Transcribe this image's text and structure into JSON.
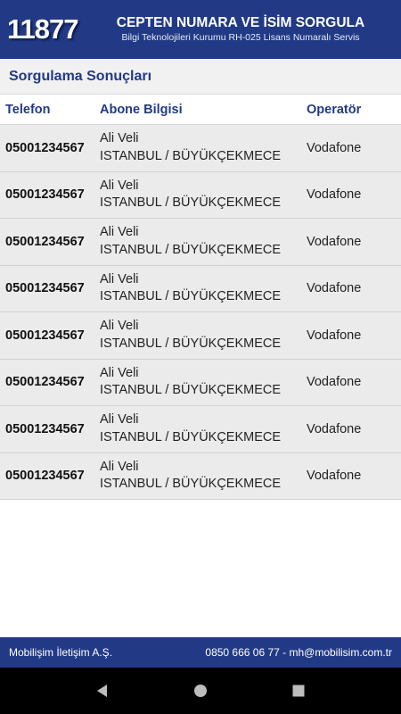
{
  "header": {
    "logo": "11877",
    "title": "CEPTEN NUMARA VE İSİM SORGULA",
    "subtitle": "Bilgi Teknolojileri Kurumu RH-025 Lisans Numaralı Servis"
  },
  "section": {
    "title": "Sorgulama Sonuçları"
  },
  "table": {
    "columns": [
      "Telefon",
      "Abone Bilgisi",
      "Operatör"
    ],
    "rows": [
      {
        "phone": "05001234567",
        "name": "Ali Veli",
        "location": "ISTANBUL / BÜYÜKÇEKMECE",
        "operator": "Vodafone"
      },
      {
        "phone": "05001234567",
        "name": "Ali Veli",
        "location": "ISTANBUL / BÜYÜKÇEKMECE",
        "operator": "Vodafone"
      },
      {
        "phone": "05001234567",
        "name": "Ali Veli",
        "location": "ISTANBUL / BÜYÜKÇEKMECE",
        "operator": "Vodafone"
      },
      {
        "phone": "05001234567",
        "name": "Ali Veli",
        "location": "ISTANBUL / BÜYÜKÇEKMECE",
        "operator": "Vodafone"
      },
      {
        "phone": "05001234567",
        "name": "Ali Veli",
        "location": "ISTANBUL / BÜYÜKÇEKMECE",
        "operator": "Vodafone"
      },
      {
        "phone": "05001234567",
        "name": "Ali Veli",
        "location": "ISTANBUL / BÜYÜKÇEKMECE",
        "operator": "Vodafone"
      },
      {
        "phone": "05001234567",
        "name": "Ali Veli",
        "location": "ISTANBUL / BÜYÜKÇEKMECE",
        "operator": "Vodafone"
      },
      {
        "phone": "05001234567",
        "name": "Ali Veli",
        "location": "ISTANBUL / BÜYÜKÇEKMECE",
        "operator": "Vodafone"
      }
    ]
  },
  "footer": {
    "company": "Mobilişim İletişim A.Ş.",
    "contact": "0850 666 06 77 - mh@mobilisim.com.tr"
  },
  "navbar": {
    "icons": [
      "back-icon",
      "home-icon",
      "recents-icon"
    ]
  },
  "colors": {
    "brand": "#223a86",
    "row_bg": "#ebebeb",
    "section_bg": "#f1f1f1"
  }
}
